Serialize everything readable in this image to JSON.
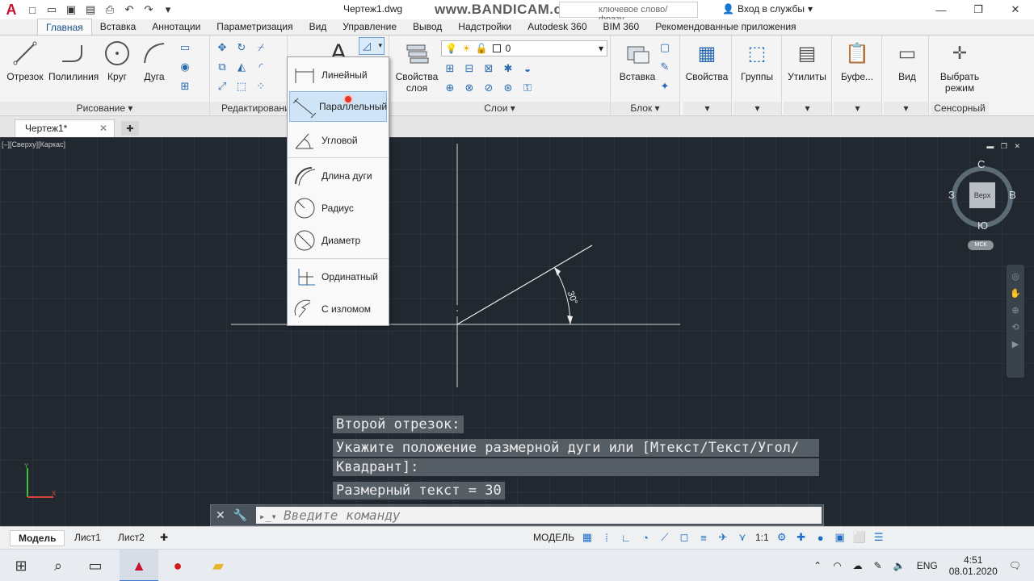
{
  "window": {
    "doc_title": "Чертеж1.dwg",
    "watermark": "www.BANDICAM.com",
    "search_placeholder": "ключевое слово/фразу",
    "signin": "Вход в службы"
  },
  "ribbon_tabs": [
    "Главная",
    "Вставка",
    "Аннотации",
    "Параметризация",
    "Вид",
    "Управление",
    "Вывод",
    "Надстройки",
    "Autodesk 360",
    "BIM 360",
    "Рекомендованные приложения"
  ],
  "draw_panel": {
    "tools": [
      "Отрезок",
      "Полилиния",
      "Круг",
      "Дуга"
    ],
    "label": "Рисование"
  },
  "modify_panel": {
    "label": "Редактирование"
  },
  "layer_panel": {
    "props_label": "Свойства слоя",
    "layer_name": "0",
    "label": "Слои"
  },
  "block_panel": {
    "insert_label": "Вставка",
    "label": "Блок"
  },
  "right_panels": [
    "Свойства",
    "Группы",
    "Утилиты",
    "Буфе...",
    "Вид",
    "Выбрать режим"
  ],
  "touch_label": "Сенсорный",
  "file_tab": "Чертеж1*",
  "viewport": {
    "label": "[–][Сверху][Каркас]",
    "dim_text": "30°"
  },
  "viewcube": {
    "face": "Верх",
    "north": "С",
    "south": "Ю",
    "west": "З",
    "east": "В",
    "wcs": "МСК"
  },
  "dimension_menu": {
    "items": [
      "Линейный",
      "Параллельный",
      "Угловой",
      "Длина дуги",
      "Радиус",
      "Диаметр",
      "Ординатный",
      "С изломом"
    ],
    "selected_index": 1
  },
  "command": {
    "history": [
      "Второй отрезок:",
      "Укажите положение размерной дуги или [Мтекст/Текст/Угол/",
      "Квадрант]:",
      "Размерный текст = 30"
    ],
    "placeholder": "Введите команду"
  },
  "status": {
    "layout_tabs": [
      "Модель",
      "Лист1",
      "Лист2"
    ],
    "space": "МОДЕЛЬ",
    "scale": "1:1"
  },
  "taskbar": {
    "lang": "ENG",
    "time": "4:51",
    "date": "08.01.2020"
  }
}
